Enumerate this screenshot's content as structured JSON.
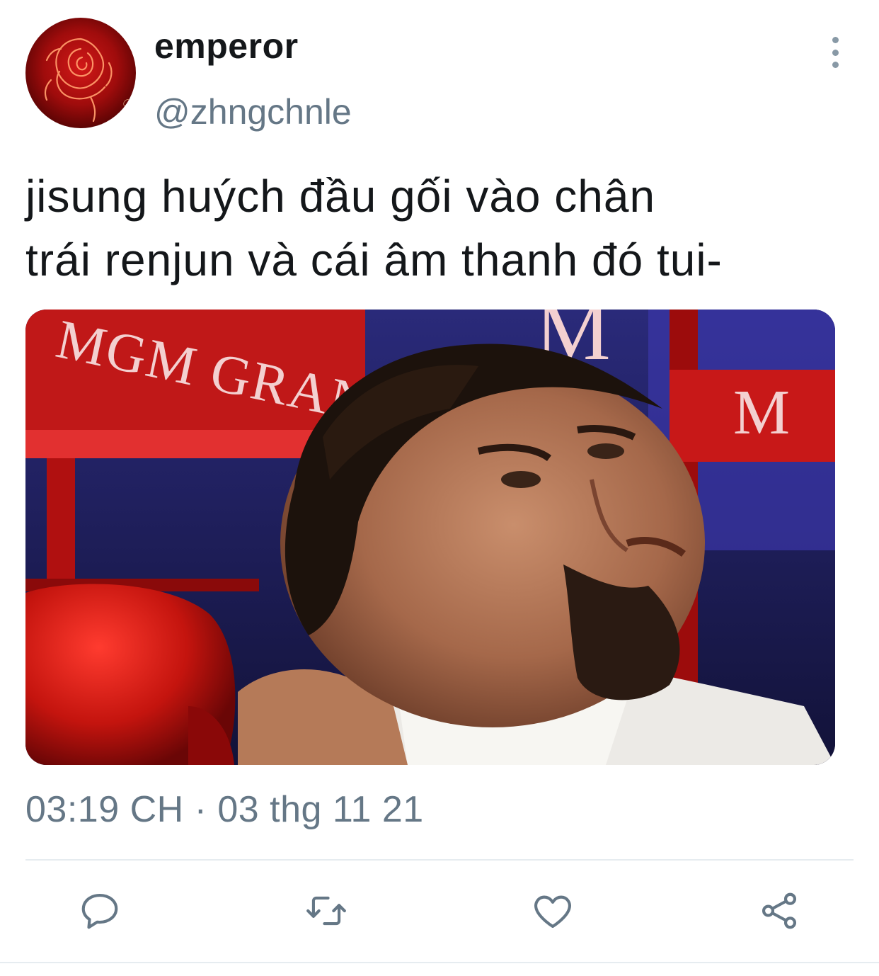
{
  "tweet": {
    "display_name": "emperor",
    "handle": "@zhngchnle",
    "text_line1": "jisung huých đầu gối vào chân",
    "text_line2": "trái renjun và cái âm thanh đó tui-",
    "timestamp": "03:19 CH · 03 thg 11 21"
  },
  "media": {
    "sign_left": "MGM GRAND",
    "sign_top": "M",
    "sign_right": "M"
  },
  "icons": {
    "avatar": "red-neon-rose-avatar",
    "more": "more-vertical-icon",
    "reply": "reply-icon",
    "retweet": "retweet-icon",
    "like": "heart-icon",
    "share": "share-icon"
  },
  "colors": {
    "text": "#14171a",
    "secondary": "#657786",
    "icon": "#657786",
    "divider": "#e6ecf0",
    "avatar_red": "#c41010"
  }
}
